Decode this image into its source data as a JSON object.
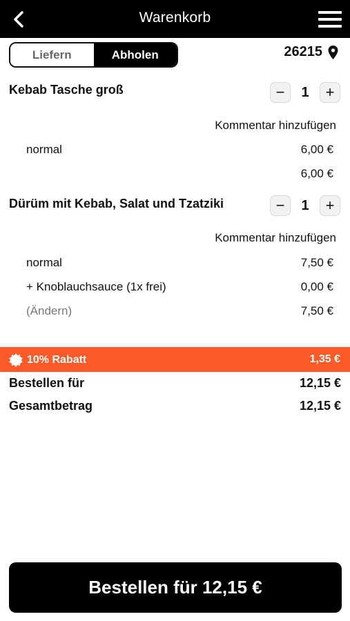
{
  "header": {
    "title": "Warenkorb",
    "back_icon": "chevron-left-icon",
    "menu_icon": "hamburger-menu-icon"
  },
  "delivery_toggle": {
    "options": [
      "Liefern",
      "Abholen"
    ],
    "selected": "Abholen"
  },
  "location": {
    "zip": "26215",
    "icon": "location-pin-icon"
  },
  "items": [
    {
      "name": "Kebab Tasche groß",
      "quantity": "1",
      "comment_label": "Kommentar hinzufügen",
      "lines": [
        {
          "label": "normal",
          "price": "6,00 €"
        }
      ],
      "subtotal": "6,00 €"
    },
    {
      "name": "Dürüm mit Kebab, Salat und Tzatziki",
      "quantity": "1",
      "comment_label": "Kommentar hinzufügen",
      "lines": [
        {
          "label": "normal",
          "price": "7,50 €"
        },
        {
          "label": "+ Knoblauchsauce (1x frei)",
          "price": "0,00 €"
        }
      ],
      "change_label": "(Ändern)",
      "subtotal": "7,50 €"
    }
  ],
  "stepper": {
    "minus": "−",
    "plus": "+"
  },
  "discount": {
    "label": "10% Rabatt",
    "amount": "1,35 €",
    "color": "#f95a27",
    "icon": "badge-icon"
  },
  "summary": {
    "order_for_label": "Bestellen für",
    "order_for_value": "12,15 €",
    "total_label": "Gesamtbetrag",
    "total_value": "12,15 €"
  },
  "cta": {
    "label": "Bestellen für 12,15 €"
  }
}
